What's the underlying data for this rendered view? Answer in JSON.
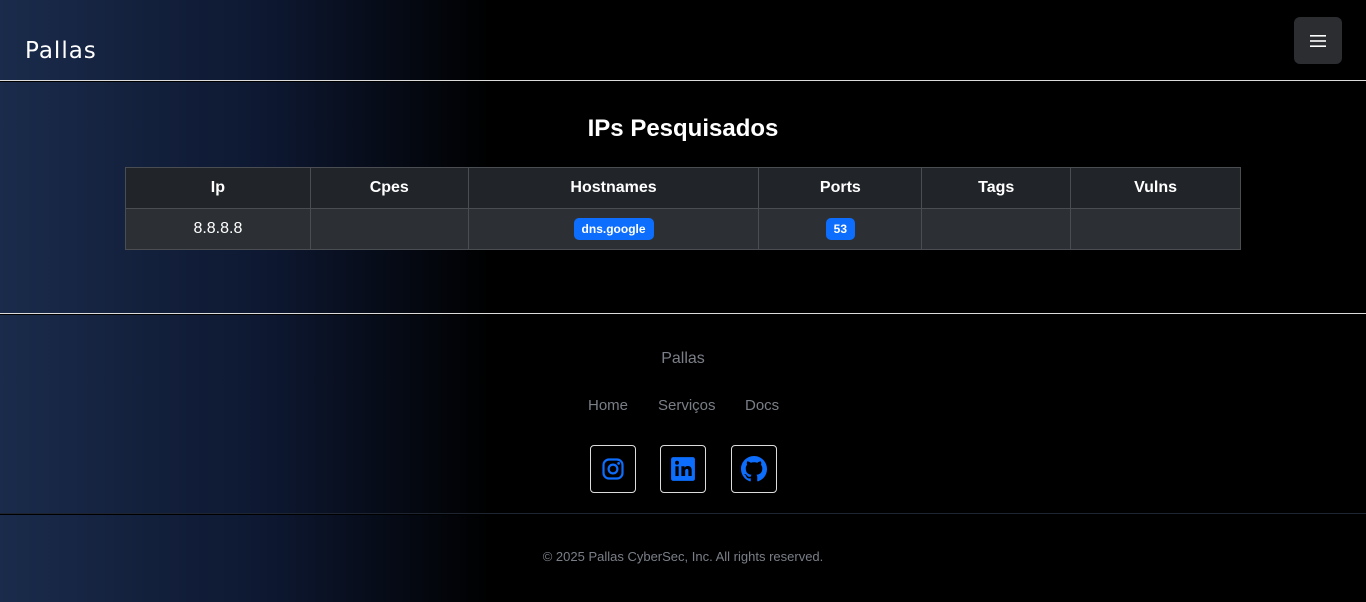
{
  "navbar": {
    "brand": "Pallas",
    "menu_icon": "hamburger-menu-icon"
  },
  "main": {
    "title": "IPs Pesquisados",
    "table": {
      "headers": [
        "Ip",
        "Cpes",
        "Hostnames",
        "Ports",
        "Tags",
        "Vulns"
      ],
      "rows": [
        {
          "ip": "8.8.8.8",
          "cpes": "",
          "hostnames": [
            "dns.google"
          ],
          "ports": [
            "53"
          ],
          "tags": "",
          "vulns": ""
        }
      ]
    }
  },
  "footer": {
    "brand": "Pallas",
    "links": [
      "Home",
      "Serviços",
      "Docs"
    ],
    "social": [
      {
        "icon": "instagram-icon"
      },
      {
        "icon": "linkedin-icon"
      },
      {
        "icon": "github-icon"
      }
    ],
    "copyright": "© 2025 Pallas CyberSec, Inc. All rights reserved."
  },
  "colors": {
    "accent": "#0d6efd",
    "muted_text": "#7a7f87",
    "table_header_bg": "#212529",
    "table_cell_bg": "#2c3034"
  }
}
